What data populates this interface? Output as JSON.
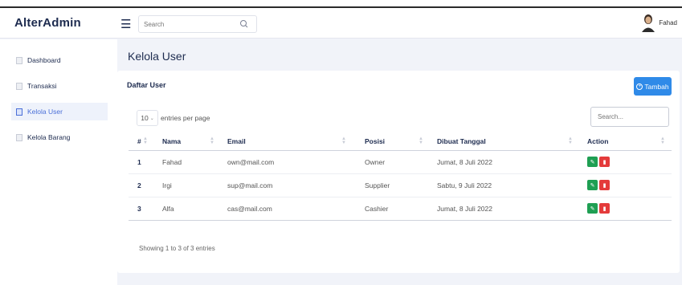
{
  "app": {
    "brand": "AlterAdmin"
  },
  "header": {
    "search_placeholder": "Search",
    "user_name": "Fahad"
  },
  "sidebar": {
    "items": [
      {
        "label": "Dashboard",
        "active": false
      },
      {
        "label": "Transaksi",
        "active": false
      },
      {
        "label": "Kelola User",
        "active": true
      },
      {
        "label": "Kelola Barang",
        "active": false
      }
    ]
  },
  "main": {
    "page_title": "Kelola User",
    "card_title": "Daftar User",
    "add_button": "Tambah",
    "per_page_value": "10",
    "per_page_label": "entries per page",
    "table_search_placeholder": "Search...",
    "columns": [
      "#",
      "Nama",
      "Email",
      "Posisi",
      "Dibuat Tanggal",
      "Action"
    ],
    "rows": [
      {
        "no": "1",
        "nama": "Fahad",
        "email": "own@mail.com",
        "posisi": "Owner",
        "tanggal": "Jumat, 8 Juli 2022"
      },
      {
        "no": "2",
        "nama": "Irgi",
        "email": "sup@mail.com",
        "posisi": "Supplier",
        "tanggal": "Sabtu, 9 Juli 2022"
      },
      {
        "no": "3",
        "nama": "Alfa",
        "email": "cas@mail.com",
        "posisi": "Cashier",
        "tanggal": "Jumat, 8 Juli 2022"
      }
    ],
    "info": "Showing 1 to 3 of 3 entries"
  },
  "colors": {
    "primary": "#2f8ae8",
    "edit": "#1f9f53",
    "delete": "#e43b3b",
    "brand_text": "#1d2b4f"
  },
  "icons": {
    "menu": "hamburger-icon",
    "search": "search-icon",
    "edit": "edit-icon",
    "delete": "trash-icon"
  }
}
